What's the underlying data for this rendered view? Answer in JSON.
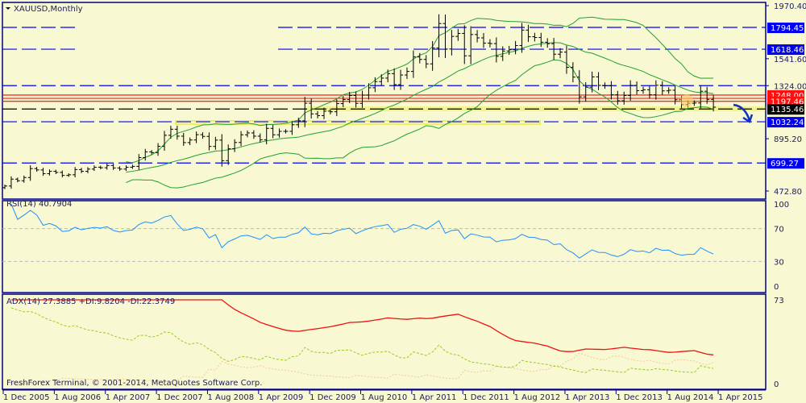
{
  "window": {
    "symbol_title": "XAUUSD,Monthly",
    "copyright": "FreshForex Terminal, © 2001-2014, MetaQuotes Software Corp."
  },
  "colors": {
    "background": "#f8f8d2",
    "frame": "#00008b",
    "bars": "#000000",
    "bands": "#22a033",
    "rsi": "#1e90ff",
    "adx": "#ee1111",
    "plus_di": "#99cc22",
    "minus_di": "#f5c8a0",
    "level_blue": "#0000ff",
    "level_red": "#ff0000",
    "zone": "#eeee66"
  },
  "chart_data": [
    {
      "type": "ohlc",
      "title": "XAUUSD,Monthly",
      "x_start": "Dec 2005",
      "x_ticks": [
        "1 Dec 2005",
        "1 Aug 2006",
        "1 Apr 2007",
        "1 Dec 2007",
        "1 Aug 2008",
        "1 Apr 2009",
        "1 Dec 2009",
        "1 Aug 2010",
        "1 Apr 2011",
        "1 Dec 2011",
        "1 Aug 2012",
        "1 Apr 2013",
        "1 Dec 2013",
        "1 Aug 2014",
        "1 Apr 2015"
      ],
      "ylim": [
        472.8,
        1970.4
      ],
      "y_ticks": [
        "1970.40",
        "1541.60",
        "1324.00",
        "895.20",
        "472.80"
      ],
      "closes": [
        513,
        569,
        556,
        582,
        654,
        643,
        613,
        632,
        623,
        599,
        604,
        646,
        632,
        650,
        665,
        661,
        679,
        659,
        650,
        665,
        672,
        743,
        789,
        783,
        834,
        923,
        972,
        916,
        864,
        885,
        928,
        914,
        833,
        884,
        718,
        814,
        865,
        927,
        942,
        916,
        887,
        979,
        927,
        955,
        955,
        1008,
        1040,
        1182,
        1096,
        1082,
        1118,
        1113,
        1179,
        1212,
        1244,
        1181,
        1247,
        1307,
        1357,
        1385,
        1421,
        1332,
        1410,
        1439,
        1556,
        1536,
        1500,
        1628,
        1826,
        1620,
        1722,
        1746,
        1565,
        1737,
        1710,
        1668,
        1664,
        1561,
        1604,
        1614,
        1648,
        1773,
        1719,
        1713,
        1675,
        1663,
        1578,
        1595,
        1472,
        1393,
        1234,
        1312,
        1395,
        1326,
        1323,
        1250,
        1202,
        1244,
        1326,
        1284,
        1291,
        1250,
        1327,
        1282,
        1287,
        1210,
        1171,
        1182,
        1184,
        1279,
        1213,
        1150
      ],
      "levels": [
        {
          "label": "1794.45",
          "value": 1794.45,
          "color": "blue",
          "style": "dashed"
        },
        {
          "label": "1618.46",
          "value": 1618.46,
          "color": "blue",
          "style": "dashed"
        },
        {
          "label": "1324.00",
          "value": 1324.0,
          "color": "blue",
          "style": "dashed",
          "tick": true
        },
        {
          "label": "1248.00",
          "value": 1248.0,
          "color": "red",
          "style": "solid"
        },
        {
          "label": "1197.46",
          "value": 1197.46,
          "color": "red",
          "style": "solid"
        },
        {
          "label": "1135.46",
          "value": 1135.46,
          "color": "black",
          "style": "dashed"
        },
        {
          "label": "1032.24",
          "value": 1032.24,
          "color": "blue",
          "style": "dashed"
        },
        {
          "label": "699.27",
          "value": 699.27,
          "color": "blue",
          "style": "dashed"
        }
      ],
      "indicators": [
        "Bollinger Bands (20)"
      ]
    },
    {
      "type": "line",
      "title": "RSI(14) 40.7904",
      "ylim": [
        0,
        100
      ],
      "y_ticks": [
        "100",
        "70",
        "30",
        "0"
      ],
      "levels": [
        70,
        30
      ],
      "period": 14
    },
    {
      "type": "line",
      "title": "ADX(14) 27.3885 +DI:9.8204 -DI:22.3749",
      "ylim": [
        0,
        73
      ],
      "y_ticks": [
        "73",
        "0"
      ],
      "series": [
        "ADX",
        "+DI",
        "-DI"
      ],
      "period": 14
    }
  ]
}
